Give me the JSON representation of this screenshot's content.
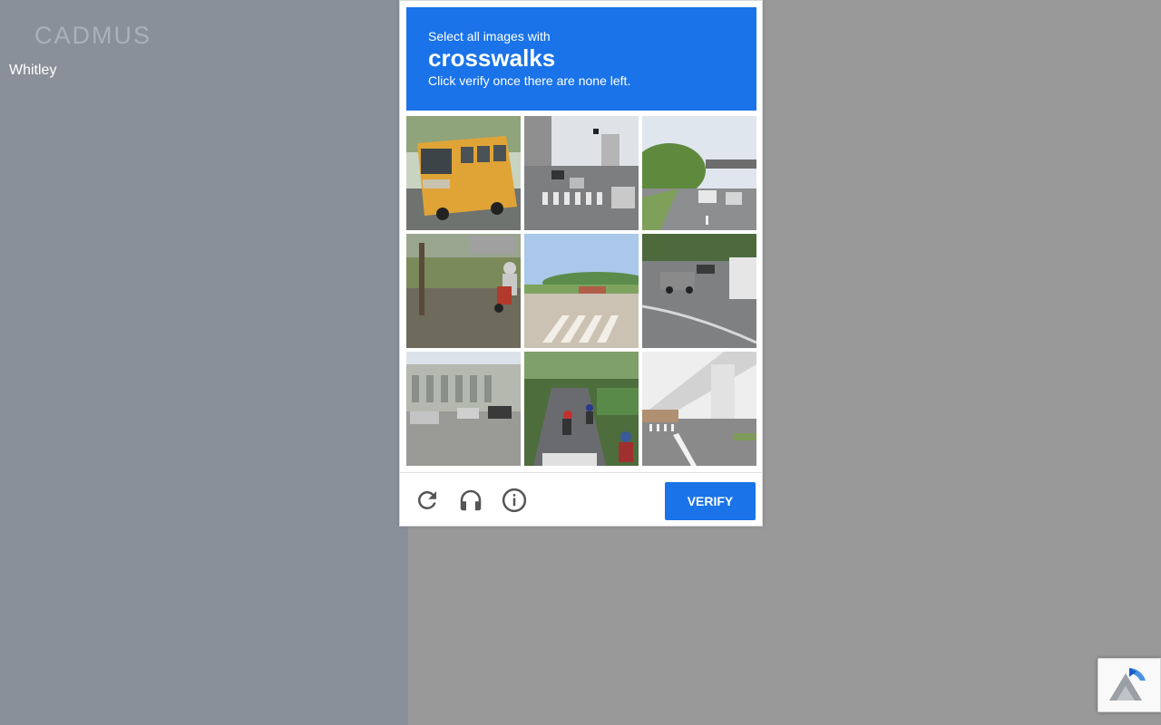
{
  "page": {
    "logo_text": "CADMUS",
    "username": "Whitley"
  },
  "captcha": {
    "instruction_prefix": "Select all images with",
    "keyword": "crosswalks",
    "instruction_suffix": "Click verify once there are none left.",
    "tiles": [
      {
        "description": "yellow bus on road"
      },
      {
        "description": "city street with crosswalk and cars"
      },
      {
        "description": "highway with overpass and trees"
      },
      {
        "description": "motorcyclist beside grassy roadside"
      },
      {
        "description": "road with crosswalk stripes and hills"
      },
      {
        "description": "road curve with van and cars"
      },
      {
        "description": "building with parked cars"
      },
      {
        "description": "motorcyclists on tree-lined road"
      },
      {
        "description": "elevated monorail over road with crosswalk"
      }
    ],
    "reload_icon": "reload-icon",
    "audio_icon": "headphones-icon",
    "info_icon": "info-icon",
    "verify_label": "VERIFY"
  },
  "colors": {
    "accent": "#1a73e8",
    "left_panel": "#8a9099",
    "backdrop": "#999999"
  },
  "badge": {
    "icon": "recaptcha-logo-icon"
  }
}
